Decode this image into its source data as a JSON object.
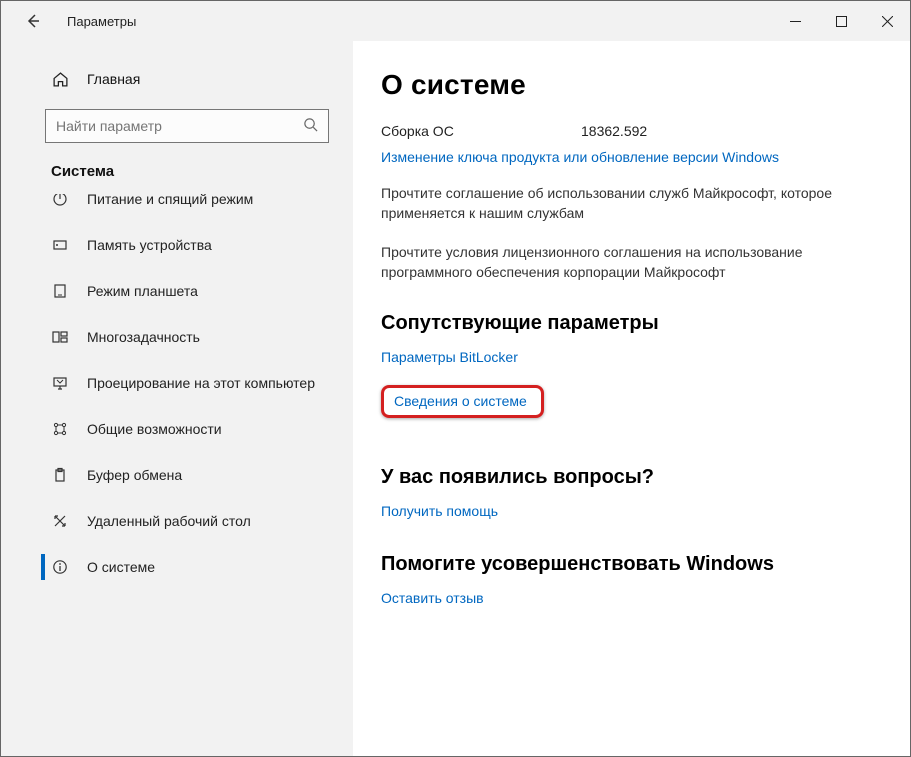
{
  "window": {
    "title": "Параметры"
  },
  "sidebar": {
    "home_label": "Главная",
    "search_placeholder": "Найти параметр",
    "section": "Система",
    "items": [
      {
        "label": "Питание и спящий режим",
        "icon": "power-icon"
      },
      {
        "label": "Память устройства",
        "icon": "storage-icon"
      },
      {
        "label": "Режим планшета",
        "icon": "tablet-icon"
      },
      {
        "label": "Многозадачность",
        "icon": "multitask-icon"
      },
      {
        "label": "Проецирование на этот компьютер",
        "icon": "project-icon"
      },
      {
        "label": "Общие возможности",
        "icon": "shared-icon"
      },
      {
        "label": "Буфер обмена",
        "icon": "clipboard-icon"
      },
      {
        "label": "Удаленный рабочий стол",
        "icon": "remote-icon"
      },
      {
        "label": "О системе",
        "icon": "info-icon"
      }
    ]
  },
  "main": {
    "title": "О системе",
    "os_build_label": "Сборка ОС",
    "os_build_value": "18362.592",
    "link_change_key": "Изменение ключа продукта или обновление версии Windows",
    "para_services": "Прочтите соглашение об использовании служб Майкрософт, которое применяется к нашим службам",
    "para_license": "Прочтите условия лицензионного соглашения на использование программного обеспечения корпорации Майкрософт",
    "related_heading": "Сопутствующие параметры",
    "link_bitlocker": "Параметры BitLocker",
    "link_sysinfo": "Сведения о системе",
    "questions_heading": "У вас появились вопросы?",
    "link_help": "Получить помощь",
    "improve_heading": "Помогите усовершенствовать Windows",
    "link_feedback": "Оставить отзыв"
  }
}
